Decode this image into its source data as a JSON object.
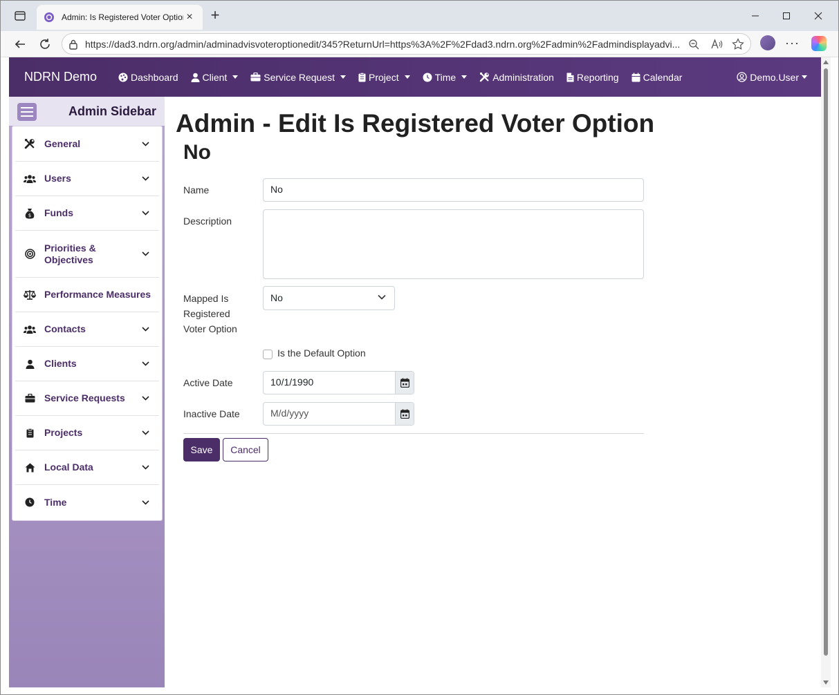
{
  "browser": {
    "tab_title": "Admin: Is Registered Voter Option",
    "url": "https://dad3.ndrn.org/admin/adminadvisvoteroptionedit/345?ReturnUrl=https%3A%2F%2Fdad3.ndrn.org%2Fadmin%2Fadmindisplayadvi..."
  },
  "navbar": {
    "brand": "NDRN Demo",
    "items": [
      {
        "label": "Dashboard",
        "icon": "palette-icon",
        "dropdown": false
      },
      {
        "label": "Client",
        "icon": "user-icon",
        "dropdown": true
      },
      {
        "label": "Service Request",
        "icon": "briefcase-icon",
        "dropdown": true
      },
      {
        "label": "Project",
        "icon": "clipboard-icon",
        "dropdown": true
      },
      {
        "label": "Time",
        "icon": "clock-icon",
        "dropdown": true
      },
      {
        "label": "Administration",
        "icon": "tools-icon",
        "dropdown": false
      },
      {
        "label": "Reporting",
        "icon": "file-icon",
        "dropdown": false
      },
      {
        "label": "Calendar",
        "icon": "calendar-icon",
        "dropdown": false
      }
    ],
    "user": "Demo.User"
  },
  "sidebar": {
    "title": "Admin Sidebar",
    "items": [
      {
        "label": "General",
        "icon": "tools-icon",
        "expandable": true
      },
      {
        "label": "Users",
        "icon": "users-icon",
        "expandable": true
      },
      {
        "label": "Funds",
        "icon": "money-bag-icon",
        "expandable": true
      },
      {
        "label": "Priorities & Objectives",
        "icon": "bullseye-icon",
        "expandable": true
      },
      {
        "label": "Performance Measures",
        "icon": "scale-icon",
        "expandable": false
      },
      {
        "label": "Contacts",
        "icon": "users-icon",
        "expandable": true
      },
      {
        "label": "Clients",
        "icon": "user-icon",
        "expandable": true
      },
      {
        "label": "Service Requests",
        "icon": "briefcase-icon",
        "expandable": true
      },
      {
        "label": "Projects",
        "icon": "clipboard-icon",
        "expandable": true
      },
      {
        "label": "Local Data",
        "icon": "house-icon",
        "expandable": true
      },
      {
        "label": "Time",
        "icon": "clock-icon",
        "expandable": true
      }
    ]
  },
  "main": {
    "title": "Admin - Edit Is Registered Voter Option",
    "subtitle": "No",
    "form": {
      "name_label": "Name",
      "name_value": "No",
      "description_label": "Description",
      "description_value": "",
      "mapped_label": "Mapped Is Registered Voter Option",
      "mapped_value": "No",
      "default_label": "Is the Default Option",
      "default_checked": false,
      "active_date_label": "Active Date",
      "active_date_value": "10/1/1990",
      "inactive_date_label": "Inactive Date",
      "inactive_date_placeholder": "M/d/yyyy",
      "save_label": "Save",
      "cancel_label": "Cancel"
    }
  },
  "colors": {
    "brand_purple": "#4b2d68",
    "sidebar_purple": "#b9a6d2"
  }
}
